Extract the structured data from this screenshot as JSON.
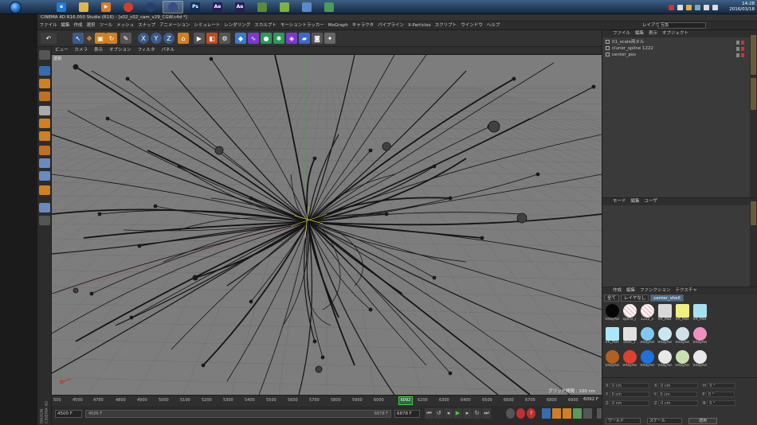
{
  "taskbar": {
    "apps": [
      {
        "icon": "internet-explorer-icon",
        "label": "e",
        "color": "#1f7ad6"
      },
      {
        "icon": "folder-icon",
        "label": "",
        "color": "#e0b64a"
      },
      {
        "icon": "media-player-icon",
        "label": "▶",
        "color": "#e07a1f"
      },
      {
        "icon": "chrome-icon",
        "label": "",
        "color": "#d43c2e"
      },
      {
        "icon": "cinema4d-icon",
        "label": "",
        "color": "#2b3c6e"
      },
      {
        "icon": "cinema4d-active-icon",
        "label": "",
        "color": "#3a4c86"
      },
      {
        "icon": "photoshop-icon",
        "label": "Ps",
        "color": "#0a2f5a"
      },
      {
        "icon": "after-effects-icon",
        "label": "Ae",
        "color": "#2a1b5a"
      },
      {
        "icon": "after-effects-2-icon",
        "label": "Ae",
        "color": "#2a1b5a"
      },
      {
        "icon": "app-icon",
        "label": "",
        "color": "#5a8a3a"
      },
      {
        "icon": "android-icon",
        "label": "",
        "color": "#7cb342"
      },
      {
        "icon": "paint-icon",
        "label": "",
        "color": "#5a8ac8"
      },
      {
        "icon": "display-icon",
        "label": "",
        "color": "#4a9a5a"
      }
    ],
    "clock_time": "14:28",
    "clock_date": "2016/03/18"
  },
  "window_title": "CINEMA 4D R16.050 Studio (R16) - [s02_c02_cam_v29_CGW.c4d *]",
  "menu": [
    "ファイル",
    "編集",
    "作成",
    "選択",
    "ツール",
    "メッシュ",
    "スナップ",
    "アニメーション",
    "シミュレート",
    "レンダリング",
    "スカルプト",
    "モーショントラッカー",
    "MoGraph",
    "キャラクタ",
    "パイプライン",
    "X-Particles",
    "スクリプト",
    "ウインドウ",
    "ヘルプ"
  ],
  "layout_label": "レイアウト:",
  "layout_value": "互換",
  "viewport": {
    "menu": [
      "ビュー",
      "カメラ",
      "表示",
      "オプション",
      "フィルタ",
      "パネル"
    ],
    "camera_label": "透視",
    "grid_label": "グリッド間隔 : 100 cm"
  },
  "timeline": {
    "ticks": [
      "500",
      "4500",
      "4700",
      "4800",
      "4900",
      "5000",
      "5100",
      "5200",
      "5300",
      "5400",
      "5500",
      "5600",
      "5700",
      "5800",
      "5900",
      "6000",
      "6092",
      "6200",
      "6300",
      "6400",
      "6500",
      "6600",
      "6700",
      "6800",
      "6900"
    ],
    "current": "6092",
    "end_label": "6092 F",
    "start_field": "4500 F",
    "range_start": "4500 F",
    "range_end": "6878 F",
    "end_field": "6878 F"
  },
  "object_manager": {
    "menu": [
      "ファイル",
      "編集",
      "表示",
      "オブジェクト"
    ],
    "objects": [
      "01_scale用ヌル",
      "cluner_spline 1222",
      "center_pos"
    ]
  },
  "attribute_manager": {
    "menu": [
      "モード",
      "編集",
      "ユーザ"
    ]
  },
  "material_manager": {
    "menu": [
      "作成",
      "編集",
      "ファンクション",
      "テクスチャ"
    ],
    "tabs": [
      "全て",
      "レイヤなし",
      "center_shell"
    ],
    "materials": [
      {
        "name": "VRayAd",
        "color": "#050505"
      },
      {
        "name": "spline_l",
        "color": "#e8b8c0"
      },
      {
        "name": "1222_s",
        "color": "#e8b8c0"
      },
      {
        "name": "VR_Mat",
        "color": "#d8d8d8"
      },
      {
        "name": "VR_Mat",
        "color": "#f0f080"
      },
      {
        "name": "VR_Mat",
        "color": "#a8e0f0"
      },
      {
        "name": "VR_Mat",
        "color": "#a8e8f8"
      },
      {
        "name": "shell_1",
        "color": "#e0e0e0"
      },
      {
        "name": "VRayAd",
        "color": "#80c8f0"
      },
      {
        "name": "VRayAd",
        "color": "#c8e8f0"
      },
      {
        "name": "VRayAd",
        "color": "#d0e0e8"
      },
      {
        "name": "VRayAd",
        "color": "#f090c0"
      },
      {
        "name": "VRayAd",
        "color": "#b06020"
      },
      {
        "name": "VRayAd",
        "color": "#e04030"
      },
      {
        "name": "VRayAd",
        "color": "#2070e0"
      },
      {
        "name": "VRayAd",
        "color": "#e8e8e8"
      },
      {
        "name": "VRayAd",
        "color": "#c8e0b0"
      },
      {
        "name": "VRayAd",
        "color": "#e8e8e8"
      }
    ]
  },
  "coordinates": {
    "rows": [
      {
        "a": "X",
        "v1": "0 cm",
        "b": "X",
        "v2": "0 cm",
        "c": "H",
        "v3": "0 °"
      },
      {
        "a": "Y",
        "v1": "0 cm",
        "b": "Y",
        "v2": "0 cm",
        "c": "P",
        "v3": "0 °"
      },
      {
        "a": "Z",
        "v1": "0 cm",
        "b": "Z",
        "v2": "0 cm",
        "c": "B",
        "v3": "0 °"
      }
    ],
    "mode1": "ワールド",
    "mode2": "スケール",
    "apply": "適用"
  },
  "brand": "MAXON CINEMA 4D"
}
